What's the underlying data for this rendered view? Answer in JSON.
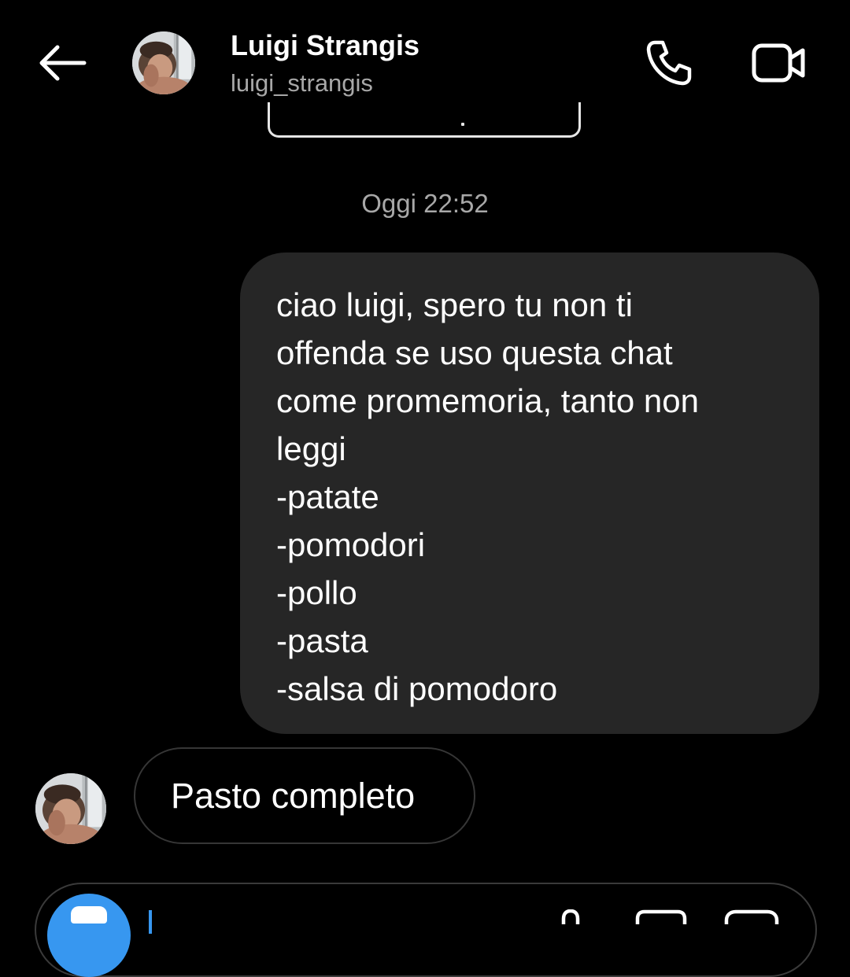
{
  "header": {
    "name": "Luigi Strangis",
    "username": "luigi_strangis",
    "back_icon": "arrow-left-icon",
    "call_icon": "phone-icon",
    "video_icon": "video-camera-icon"
  },
  "thread": {
    "timestamp": "Oggi 22:52",
    "messages": [
      {
        "direction": "outgoing",
        "lines": [
          "ciao luigi, spero tu non ti",
          "offenda se uso questa chat",
          "come promemoria, tanto non",
          "leggi",
          "-patate",
          "-pomodori",
          "-pollo",
          "-pasta",
          "-salsa di pomodoro"
        ]
      },
      {
        "direction": "incoming",
        "text": "Pasto completo"
      }
    ]
  },
  "composer": {
    "camera_icon": "camera-icon",
    "mic_icon": "microphone-icon",
    "gallery_icon": "gallery-icon",
    "sticker_icon": "sticker-icon"
  },
  "colors": {
    "background": "#000000",
    "outgoing_bubble": "#262626",
    "incoming_border": "#363636",
    "secondary_text": "#a8a8a8",
    "accent": "#3797f0"
  }
}
